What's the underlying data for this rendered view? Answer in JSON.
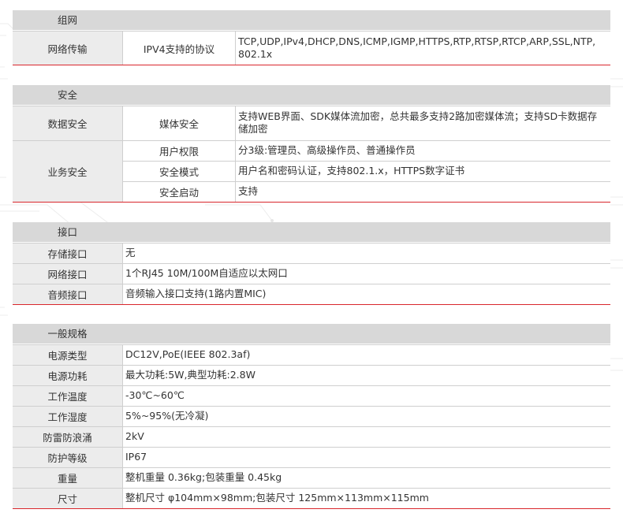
{
  "network": {
    "header": "组网",
    "rows": [
      {
        "label": "网络传输",
        "sub": "IPV4支持的协议",
        "value": "TCP,UDP,IPv4,DHCP,DNS,ICMP,IGMP,HTTPS,RTP,RTSP,RTCP,ARP,SSL,NTP, 802.1x"
      }
    ]
  },
  "security": {
    "header": "安全",
    "data_label": "数据安全",
    "data_sub": "媒体安全",
    "data_value": "支持WEB界面、SDK媒体流加密，总共最多支持2路加密媒体流；支持SD卡数据存储加密",
    "biz_label": "业务安全",
    "biz_rows": [
      {
        "sub": "用户权限",
        "value": "分3级:管理员、高级操作员、普通操作员"
      },
      {
        "sub": "安全模式",
        "value": "用户名和密码认证，支持802.1.x，HTTPS数字证书"
      },
      {
        "sub": "安全启动",
        "value": "支持"
      }
    ]
  },
  "interface": {
    "header": "接口",
    "rows": [
      {
        "label": "存储接口",
        "value": "无"
      },
      {
        "label": "网络接口",
        "value": "1个RJ45 10M/100M自适应以太网口"
      },
      {
        "label": "音频接口",
        "value": "音频输入接口支持(1路内置MIC)"
      }
    ]
  },
  "general": {
    "header": "一般规格",
    "rows": [
      {
        "label": "电源类型",
        "value": "DC12V,PoE(IEEE 802.3af)"
      },
      {
        "label": "电源功耗",
        "value": "最大功耗:5W,典型功耗:2.8W"
      },
      {
        "label": "工作温度",
        "value": "-30℃~60℃"
      },
      {
        "label": "工作湿度",
        "value": "5%~95%(无冷凝)"
      },
      {
        "label": "防雷防浪涌",
        "value": "2kV"
      },
      {
        "label": "防护等级",
        "value": "IP67"
      },
      {
        "label": "重量",
        "value": "整机重量 0.36kg;包装重量 0.45kg"
      },
      {
        "label": "尺寸",
        "value": "整机尺寸 φ104mm×98mm;包装尺寸 125mm×113mm×115mm"
      }
    ]
  }
}
